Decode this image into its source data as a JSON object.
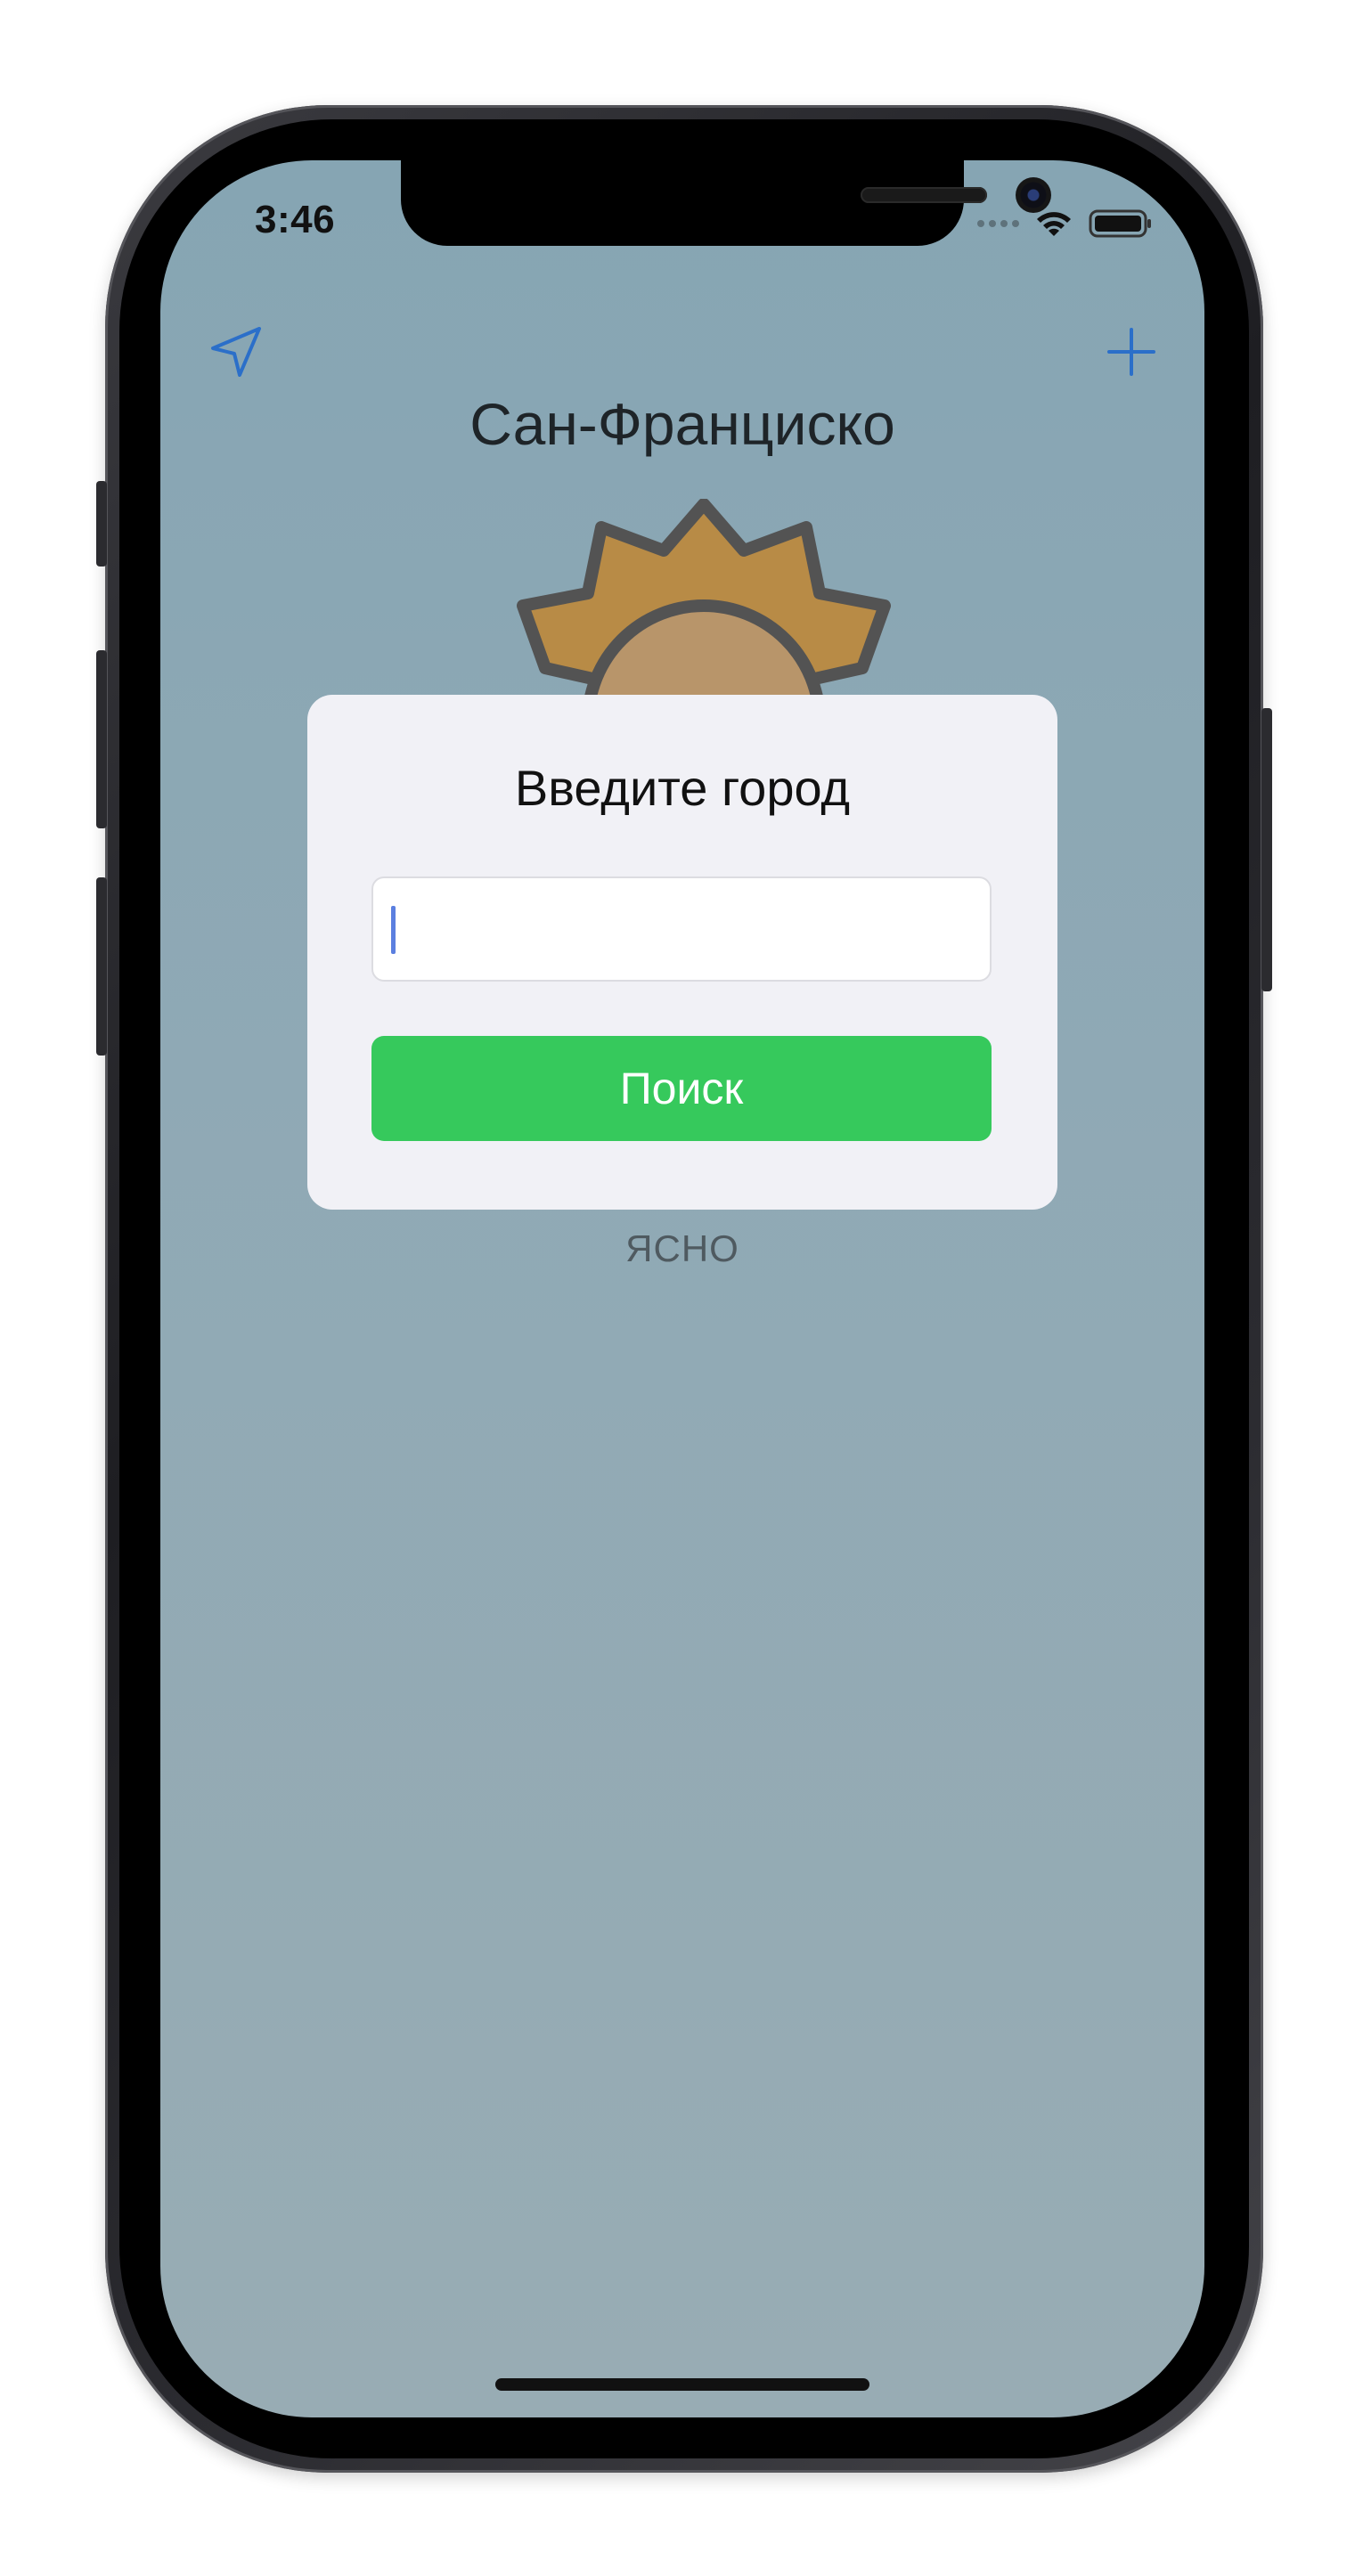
{
  "status_bar": {
    "time": "3:46"
  },
  "nav": {
    "location_icon": "location-arrow-icon",
    "add_icon": "plus-icon",
    "accent_color": "#2b6fc9"
  },
  "weather": {
    "city": "Сан-Франциско",
    "condition": "ЯСНО",
    "icon": "sun-icon"
  },
  "dialog": {
    "title": "Введите город",
    "input_value": "",
    "button_label": "Поиск",
    "button_color": "#36c95c"
  }
}
